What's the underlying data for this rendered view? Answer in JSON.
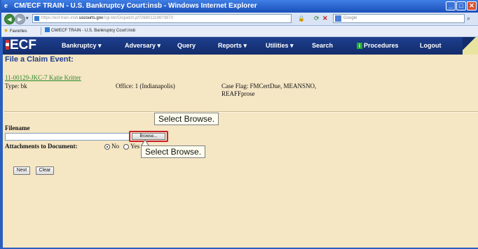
{
  "window": {
    "title": "CM/ECF TRAIN - U.S. Bankruptcy Court:insb - Windows Internet Explorer"
  },
  "address_bar": {
    "url_prefix": "https://ecf-train.insb.",
    "url_host": "uscourts.gov",
    "url_rest": "/cgi-bin/Dispatch.pl?268011196?3970",
    "search_placeholder": "Google"
  },
  "favorites_bar": {
    "favorites_label": "Favorites",
    "tab_label": "CM/ECF TRAIN - U.S. Bankruptcy Court:insb"
  },
  "ecf": {
    "logo": "ECF",
    "menu": {
      "bankruptcy": "Bankruptcy ▾",
      "adversary": "Adversary ▾",
      "query": "Query",
      "reports": "Reports ▾",
      "utilities": "Utilities ▾",
      "search": "Search",
      "procedures": "Procedures",
      "logout": "Logout"
    },
    "heading": "File a Claim Event:",
    "case": {
      "link": "11-00129-JKC-7 Katie Kritter",
      "type": "Type: bk",
      "office": "Office: 1 (Indianapolis)",
      "flags": "Case Flag: FMCertDue, MEANSNO, REAFFprose"
    },
    "form": {
      "filename_label": "Filename",
      "filename_value": "",
      "browse_label": "Browse...",
      "attachments_label": "Attachments to Document:",
      "radio_no": "No",
      "radio_yes": "Yes",
      "next_label": "Next",
      "clear_label": "Clear"
    }
  },
  "callouts": {
    "top": "Select Browse.",
    "bottom": "Select Browse."
  },
  "colors": {
    "page_background": "#f5e6c4",
    "menu_bar": "#1d3f8f",
    "highlight_border": "#c8202a",
    "case_link": "#2a8a2a"
  }
}
